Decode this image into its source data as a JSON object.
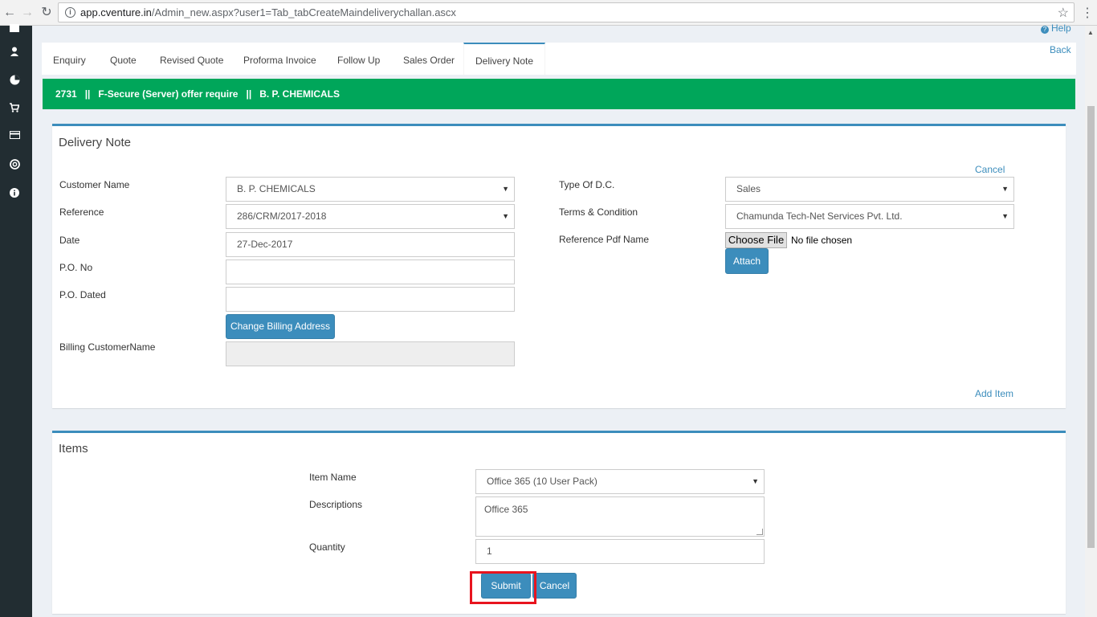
{
  "browser": {
    "back_icon": "←",
    "forward_icon": "→",
    "reload_icon": "↻",
    "url_host": "app.cventure.in",
    "url_path": "/Admin_new.aspx?user1=Tab_tabCreateMaindeliverychallan.ascx",
    "star_icon": "☆",
    "menu_icon": "⋮"
  },
  "sidebar": {
    "icons": [
      "dashboard-icon",
      "user-icon",
      "pie-chart-icon",
      "cart-icon",
      "credit-card-icon",
      "globe-icon",
      "info-icon"
    ]
  },
  "header": {
    "help_label": "Help",
    "back_label": "Back"
  },
  "tabs": [
    {
      "label": "Enquiry"
    },
    {
      "label": "Quote"
    },
    {
      "label": "Revised Quote"
    },
    {
      "label": "Proforma Invoice"
    },
    {
      "label": "Follow Up"
    },
    {
      "label": "Sales Order"
    },
    {
      "label": "Delivery Note",
      "active": true
    }
  ],
  "banner": {
    "text": "2731   ||   F-Secure (Server) offer require   ||   B. P. CHEMICALS",
    "color": "#00a65a"
  },
  "delivery_note": {
    "title": "Delivery Note",
    "cancel_link": "Cancel",
    "customer_name_label": "Customer Name",
    "customer_name_value": "B. P. CHEMICALS",
    "reference_label": "Reference",
    "reference_value": "286/CRM/2017-2018",
    "date_label": "Date",
    "date_value": "27-Dec-2017",
    "po_no_label": "P.O. No",
    "po_no_value": "",
    "po_dated_label": "P.O. Dated",
    "po_dated_value": "",
    "change_billing_button": "Change Billing Address",
    "billing_customer_label": "Billing CustomerName",
    "billing_customer_value": "",
    "type_dc_label": "Type Of D.C.",
    "type_dc_value": "Sales",
    "terms_label": "Terms & Condition",
    "terms_value": "Chamunda Tech-Net Services Pvt. Ltd.",
    "ref_pdf_label": "Reference Pdf Name",
    "choose_file_button": "Choose File",
    "no_file_text": "No file chosen",
    "attach_button": "Attach",
    "add_item_link": "Add Item"
  },
  "items": {
    "title": "Items",
    "item_name_label": "Item Name",
    "item_name_value": "Office 365 (10 User Pack)",
    "descriptions_label": "Descriptions",
    "descriptions_value": "Office 365",
    "quantity_label": "Quantity",
    "quantity_value": "1",
    "submit_button": "Submit",
    "cancel_button": "Cancel"
  },
  "colors": {
    "primary": "#3c8dbc",
    "sidebar": "#222d32",
    "highlight": "#e8141e"
  }
}
